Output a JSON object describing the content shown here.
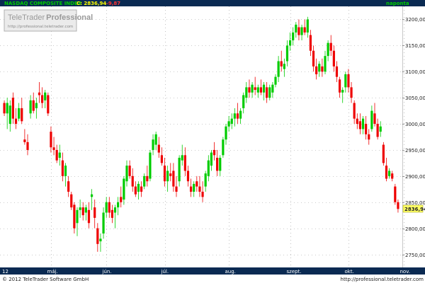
{
  "header": {
    "symbol": "NASDAQ COMPOSITE INDEX",
    "close_text": "C: 2836,94",
    "change_text": "-9,87",
    "period": "naponta"
  },
  "watermark": {
    "brand": "TeleTrader",
    "brand_bold": "Professional",
    "url": "http://professional.teletrader.com"
  },
  "footer": {
    "copyright": "© 2012 TeleTrader Software GmbH",
    "url": "http://professional.teletrader.com"
  },
  "last_price_label": "2836,94",
  "colors": {
    "background": "#ffffff",
    "axis_bar": "#0a2a52",
    "up": "#00cc00",
    "down": "#ee0000",
    "grid": "#9a9a9a",
    "header_green": "#00cc00",
    "header_yellow": "#ffff00",
    "header_red": "#ff3333",
    "last_price_bg": "#ffff66"
  },
  "chart_data": {
    "type": "candlestick",
    "ylim": [
      2725,
      3225
    ],
    "yticks": [
      2750,
      2800,
      2850,
      2900,
      2950,
      3000,
      3050,
      3100,
      3150,
      3200
    ],
    "ytick_labels": [
      "2750,00",
      "2800,00",
      "2850,00",
      "2900,00",
      "2950,00",
      "3000,00",
      "3050,00",
      "3100,00",
      "3150,00",
      "3200,00"
    ],
    "xtick_labels": [
      "12",
      "máj.",
      "jún.",
      "júl.",
      "aug.",
      "szept.",
      "okt.",
      "nov."
    ],
    "grid": true,
    "candles": [
      [
        3040,
        3045,
        3015,
        3020
      ],
      [
        3020,
        3050,
        2990,
        3040
      ],
      [
        3000,
        3045,
        2985,
        3035
      ],
      [
        3050,
        3060,
        3000,
        3010
      ],
      [
        3010,
        3030,
        2990,
        3000
      ],
      [
        3010,
        3040,
        3005,
        3030
      ],
      [
        3030,
        3050,
        3000,
        3005
      ],
      [
        2970,
        2990,
        2960,
        2965
      ],
      [
        2965,
        2980,
        2940,
        2950
      ],
      [
        3020,
        3055,
        3010,
        3045
      ],
      [
        3045,
        3060,
        3020,
        3025
      ],
      [
        3030,
        3050,
        3010,
        3040
      ],
      [
        3060,
        3080,
        3040,
        3055
      ],
      [
        3055,
        3070,
        3030,
        3040
      ],
      [
        3045,
        3065,
        3030,
        3060
      ],
      [
        3055,
        3060,
        3015,
        3020
      ],
      [
        2985,
        2995,
        2945,
        2955
      ],
      [
        2955,
        2975,
        2940,
        2950
      ],
      [
        2950,
        2960,
        2925,
        2930
      ],
      [
        2935,
        2960,
        2920,
        2945
      ],
      [
        2930,
        2945,
        2890,
        2900
      ],
      [
        2900,
        2925,
        2880,
        2920
      ],
      [
        2890,
        2900,
        2860,
        2870
      ],
      [
        2865,
        2870,
        2835,
        2840
      ],
      [
        2845,
        2850,
        2790,
        2800
      ],
      [
        2810,
        2840,
        2785,
        2835
      ],
      [
        2835,
        2855,
        2820,
        2840
      ],
      [
        2840,
        2850,
        2815,
        2825
      ],
      [
        2830,
        2845,
        2815,
        2840
      ],
      [
        2835,
        2850,
        2800,
        2810
      ],
      [
        2860,
        2875,
        2835,
        2865
      ],
      [
        2840,
        2855,
        2800,
        2820
      ],
      [
        2800,
        2810,
        2755,
        2770
      ],
      [
        2775,
        2790,
        2755,
        2780
      ],
      [
        2790,
        2840,
        2780,
        2830
      ],
      [
        2830,
        2860,
        2820,
        2850
      ],
      [
        2850,
        2860,
        2820,
        2830
      ],
      [
        2835,
        2845,
        2810,
        2820
      ],
      [
        2830,
        2845,
        2800,
        2840
      ],
      [
        2840,
        2860,
        2825,
        2850
      ],
      [
        2860,
        2880,
        2840,
        2850
      ],
      [
        2855,
        2900,
        2845,
        2895
      ],
      [
        2890,
        2930,
        2880,
        2920
      ],
      [
        2920,
        2930,
        2895,
        2900
      ],
      [
        2900,
        2915,
        2870,
        2880
      ],
      [
        2880,
        2890,
        2860,
        2865
      ],
      [
        2870,
        2890,
        2855,
        2885
      ],
      [
        2880,
        2890,
        2860,
        2870
      ],
      [
        2880,
        2905,
        2875,
        2900
      ],
      [
        2900,
        2920,
        2880,
        2890
      ],
      [
        2895,
        2950,
        2890,
        2945
      ],
      [
        2950,
        2980,
        2940,
        2970
      ],
      [
        2960,
        2985,
        2950,
        2980
      ],
      [
        2960,
        2975,
        2935,
        2945
      ],
      [
        2940,
        2955,
        2920,
        2925
      ],
      [
        2920,
        2935,
        2880,
        2890
      ],
      [
        2890,
        2920,
        2870,
        2910
      ],
      [
        2905,
        2925,
        2890,
        2900
      ],
      [
        2910,
        2925,
        2870,
        2880
      ],
      [
        2880,
        2900,
        2860,
        2870
      ],
      [
        2890,
        2940,
        2880,
        2935
      ],
      [
        2930,
        2960,
        2920,
        2940
      ],
      [
        2940,
        2955,
        2900,
        2910
      ],
      [
        2910,
        2920,
        2880,
        2890
      ],
      [
        2880,
        2895,
        2860,
        2870
      ],
      [
        2870,
        2890,
        2860,
        2885
      ],
      [
        2890,
        2900,
        2870,
        2880
      ],
      [
        2880,
        2900,
        2860,
        2870
      ],
      [
        2870,
        2890,
        2850,
        2860
      ],
      [
        2880,
        2910,
        2870,
        2905
      ],
      [
        2900,
        2940,
        2890,
        2930
      ],
      [
        2920,
        2950,
        2910,
        2945
      ],
      [
        2950,
        2965,
        2930,
        2940
      ],
      [
        2935,
        2950,
        2900,
        2910
      ],
      [
        2910,
        2940,
        2900,
        2935
      ],
      [
        2940,
        2975,
        2935,
        2970
      ],
      [
        2970,
        3000,
        2960,
        2995
      ],
      [
        2995,
        3015,
        2985,
        3005
      ],
      [
        3000,
        3020,
        2990,
        3010
      ],
      [
        3010,
        3030,
        2995,
        3020
      ],
      [
        3020,
        3040,
        3000,
        3010
      ],
      [
        3010,
        3030,
        3000,
        3025
      ],
      [
        3030,
        3060,
        3020,
        3055
      ],
      [
        3050,
        3080,
        3040,
        3070
      ],
      [
        3070,
        3085,
        3050,
        3060
      ],
      [
        3060,
        3080,
        3050,
        3075
      ],
      [
        3070,
        3090,
        3055,
        3065
      ],
      [
        3060,
        3075,
        3050,
        3070
      ],
      [
        3070,
        3085,
        3055,
        3060
      ],
      [
        3060,
        3080,
        3045,
        3075
      ],
      [
        3070,
        3080,
        3040,
        3050
      ],
      [
        3050,
        3075,
        3045,
        3070
      ],
      [
        3060,
        3080,
        3050,
        3075
      ],
      [
        3075,
        3095,
        3070,
        3090
      ],
      [
        3090,
        3130,
        3080,
        3120
      ],
      [
        3120,
        3140,
        3100,
        3110
      ],
      [
        3105,
        3125,
        3090,
        3115
      ],
      [
        3120,
        3160,
        3110,
        3150
      ],
      [
        3150,
        3175,
        3140,
        3160
      ],
      [
        3160,
        3185,
        3150,
        3175
      ],
      [
        3175,
        3195,
        3165,
        3190
      ],
      [
        3185,
        3200,
        3160,
        3170
      ],
      [
        3170,
        3190,
        3160,
        3185
      ],
      [
        3185,
        3200,
        3170,
        3175
      ],
      [
        3175,
        3205,
        3165,
        3200
      ],
      [
        3170,
        3180,
        3130,
        3140
      ],
      [
        3140,
        3150,
        3100,
        3110
      ],
      [
        3110,
        3125,
        3085,
        3095
      ],
      [
        3100,
        3120,
        3090,
        3115
      ],
      [
        3110,
        3125,
        3090,
        3100
      ],
      [
        3100,
        3140,
        3095,
        3130
      ],
      [
        3130,
        3160,
        3120,
        3155
      ],
      [
        3155,
        3170,
        3130,
        3140
      ],
      [
        3140,
        3150,
        3100,
        3110
      ],
      [
        3110,
        3120,
        3080,
        3090
      ],
      [
        3085,
        3090,
        3050,
        3060
      ],
      [
        3060,
        3070,
        3040,
        3065
      ],
      [
        3070,
        3100,
        3060,
        3095
      ],
      [
        3095,
        3105,
        3060,
        3070
      ],
      [
        3070,
        3080,
        3040,
        3050
      ],
      [
        3040,
        3045,
        3000,
        3010
      ],
      [
        3010,
        3020,
        2990,
        3000
      ],
      [
        3005,
        3020,
        2980,
        2990
      ],
      [
        2990,
        3015,
        2980,
        3010
      ],
      [
        3000,
        3015,
        2970,
        2980
      ],
      [
        2980,
        2990,
        2960,
        2970
      ],
      [
        2990,
        3035,
        2985,
        3025
      ],
      [
        3020,
        3040,
        2995,
        3000
      ],
      [
        3000,
        3010,
        2970,
        2975
      ],
      [
        2985,
        3005,
        2975,
        2995
      ],
      [
        2960,
        2965,
        2920,
        2925
      ],
      [
        2920,
        2935,
        2890,
        2895
      ],
      [
        2900,
        2915,
        2895,
        2910
      ],
      [
        2905,
        2910,
        2890,
        2895
      ],
      [
        2880,
        2885,
        2845,
        2850
      ],
      [
        2850,
        2855,
        2830,
        2837
      ]
    ]
  }
}
